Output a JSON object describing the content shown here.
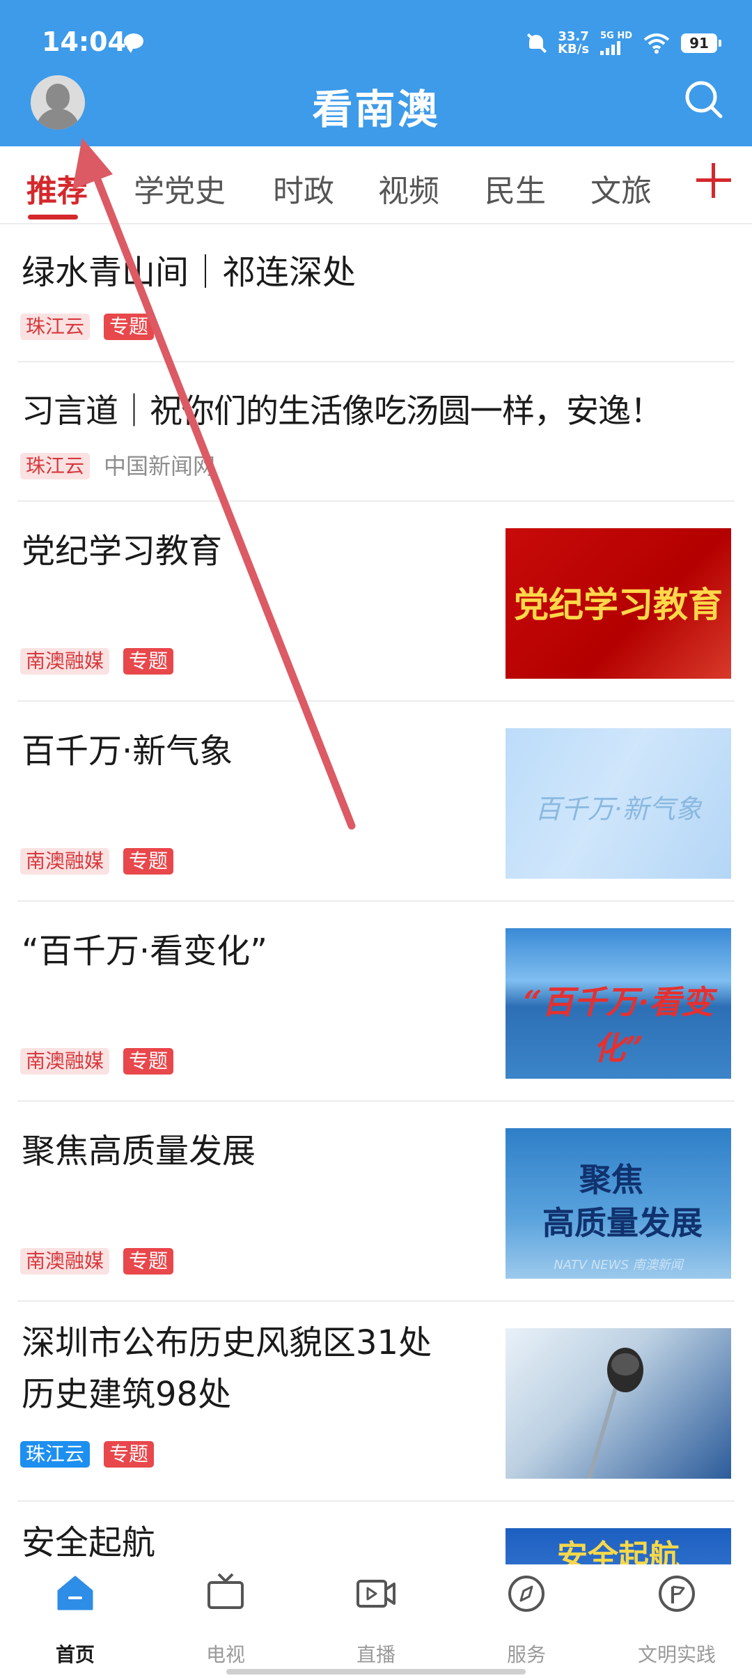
{
  "status_bar": {
    "time": "14:04",
    "net_speed_value": "33.7",
    "net_speed_unit": "KB/s",
    "signal_label": "5G HD",
    "battery": "91"
  },
  "header": {
    "title": "看南澳",
    "accent_color": "#3d9be9"
  },
  "tabs": [
    {
      "label": "推荐",
      "active": true
    },
    {
      "label": "学党史"
    },
    {
      "label": "时政"
    },
    {
      "label": "视频"
    },
    {
      "label": "民生"
    },
    {
      "label": "文旅"
    }
  ],
  "feed": [
    {
      "title": "绿水青山间｜祁连深处",
      "tags": [
        "珠江云",
        "专题"
      ]
    },
    {
      "title": "习言道｜祝你们的生活像吃汤圆一样，安逸！",
      "tags": [
        "珠江云"
      ],
      "source": "中国新闻网"
    },
    {
      "title": "党纪学习教育",
      "tags": [
        "南澳融媒",
        "专题"
      ],
      "thumb_text": "党纪学习教育"
    },
    {
      "title": "百千万·新气象",
      "tags": [
        "南澳融媒",
        "专题"
      ],
      "thumb_text": "百千万·新气象"
    },
    {
      "title": "“百千万·看变化”",
      "tags": [
        "南澳融媒",
        "专题"
      ],
      "thumb_text": "“百千万·看变化”"
    },
    {
      "title": "聚焦高质量发展",
      "tags": [
        "南澳融媒",
        "专题"
      ],
      "thumb_text_line1": "聚焦",
      "thumb_text_line2": "高质量发展",
      "thumb_caption": "NATV NEWS 南澳新闻"
    },
    {
      "title_line1": "深圳市公布历史风貌区31处",
      "title_line2": "历史建筑98处",
      "tags": [
        "珠江云",
        "专题"
      ]
    },
    {
      "title": "安全起航",
      "thumb_text": "安全起航"
    }
  ],
  "bottom_nav": [
    {
      "label": "首页",
      "icon": "home-icon",
      "active": true
    },
    {
      "label": "电视",
      "icon": "tv-icon"
    },
    {
      "label": "直播",
      "icon": "live-icon"
    },
    {
      "label": "服务",
      "icon": "compass-icon"
    },
    {
      "label": "文明实践",
      "icon": "flag-circle-icon"
    }
  ],
  "colors": {
    "tab_active": "#d4282c",
    "tag_red": "#e8474b",
    "tag_blue": "#1d8ff0",
    "annotation_arrow": "#dc5a64"
  }
}
